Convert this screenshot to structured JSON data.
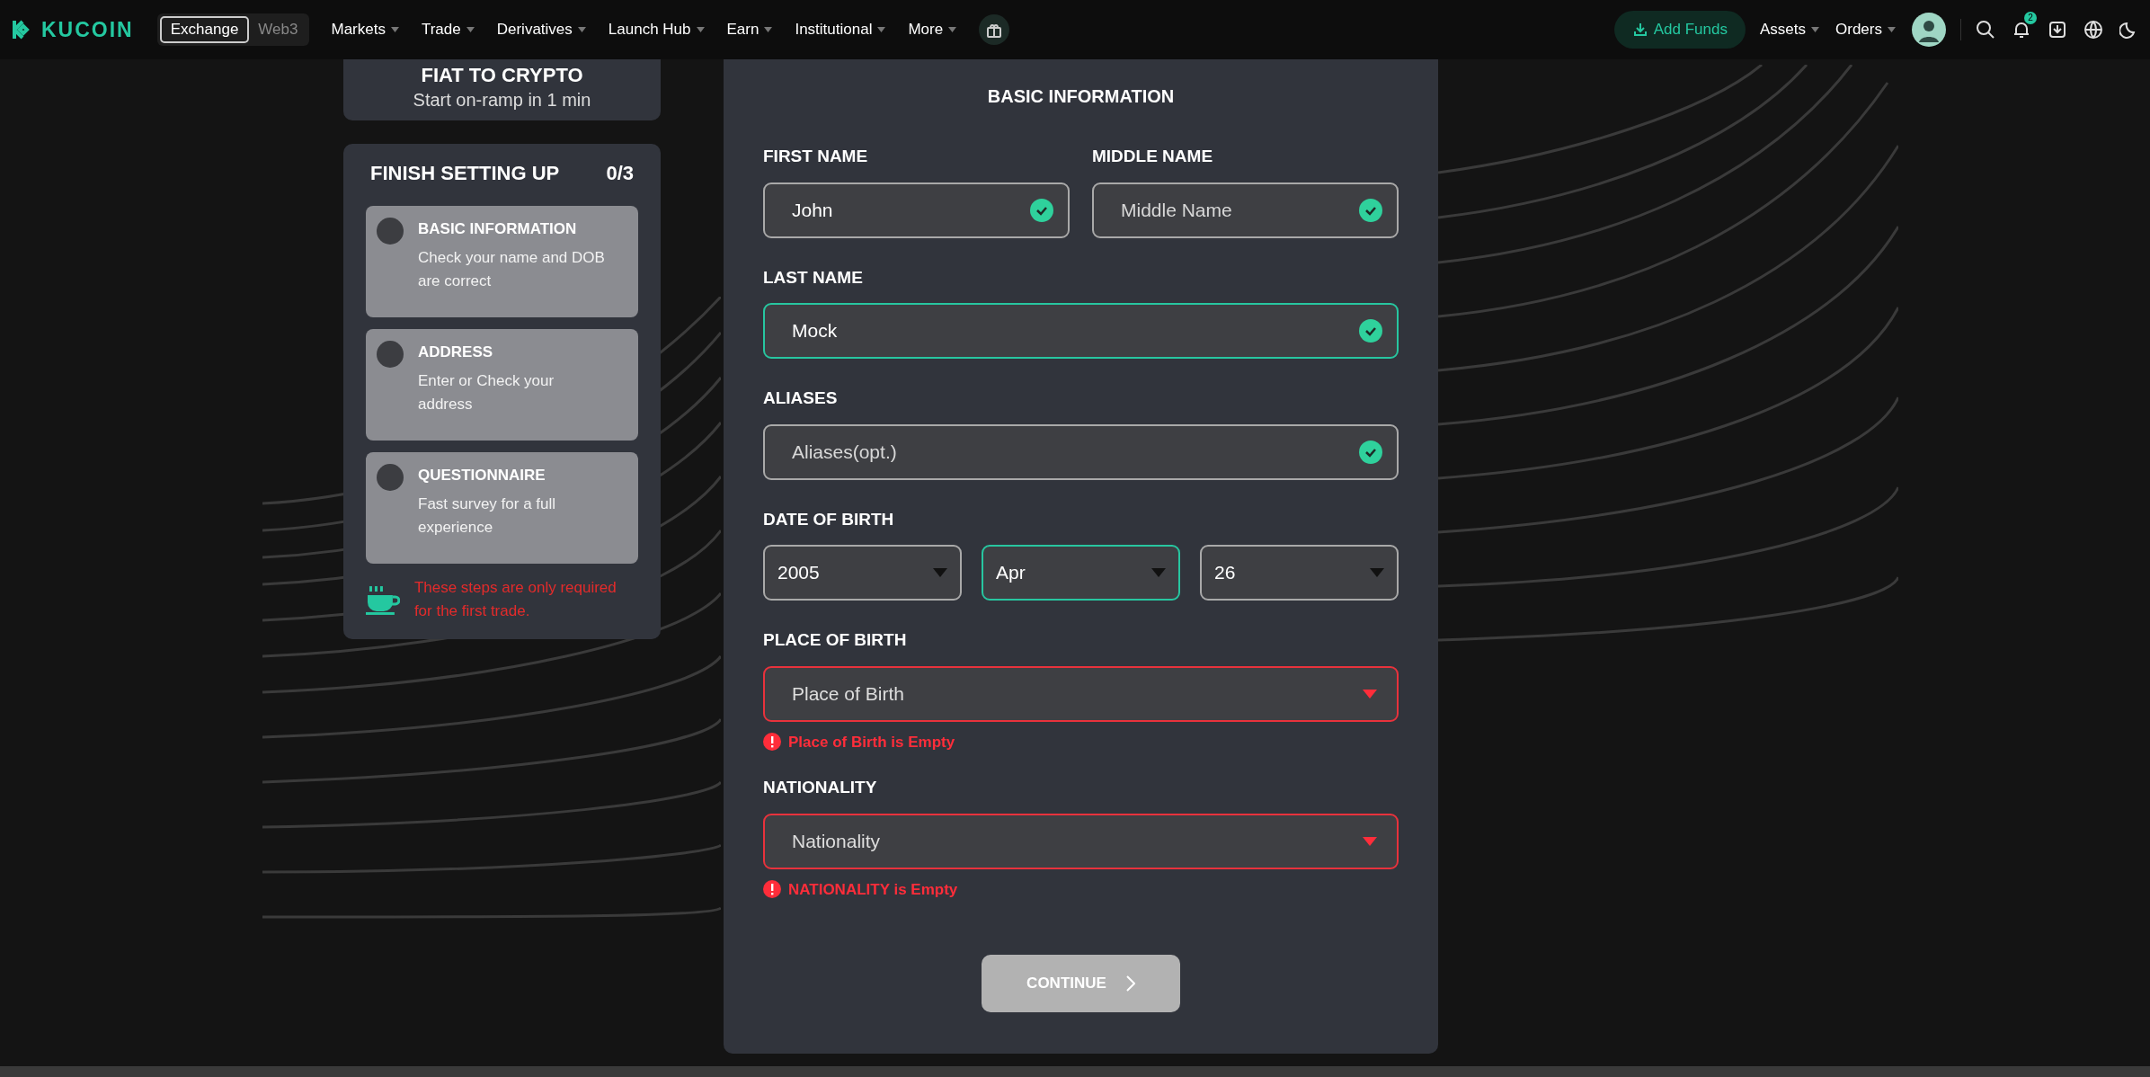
{
  "nav": {
    "logo": "KUCOIN",
    "mode_tabs": [
      {
        "label": "Exchange",
        "selected": true
      },
      {
        "label": "Web3",
        "selected": false
      }
    ],
    "menu": [
      "Markets",
      "Trade",
      "Derivatives",
      "Launch Hub",
      "Earn",
      "Institutional",
      "More"
    ],
    "add_funds": "Add Funds",
    "account_menu": [
      "Assets",
      "Orders"
    ],
    "notification_count": "2"
  },
  "promo": {
    "title": "FIAT TO CRYPTO",
    "subtitle": "Start on-ramp in 1 min"
  },
  "setup": {
    "title": "FINISH SETTING UP",
    "progress": "0/3",
    "steps": [
      {
        "title": "BASIC INFORMATION",
        "description": "Check your name and DOB are correct",
        "done": false
      },
      {
        "title": "ADDRESS",
        "description": "Enter or Check your address",
        "done": false
      },
      {
        "title": "QUESTIONNAIRE",
        "description": "Fast survey for a full experience",
        "done": false
      }
    ],
    "note": "These steps are only required for the first trade."
  },
  "form": {
    "title": "BASIC INFORMATION",
    "rows": [
      [
        {
          "label": "FIRST NAME",
          "controls": [
            {
              "kind": "text",
              "value": "John",
              "valid": true,
              "focused": false
            }
          ]
        },
        {
          "label": "MIDDLE NAME",
          "controls": [
            {
              "kind": "text",
              "placeholder": "Middle Name",
              "valid": true,
              "focused": false
            }
          ]
        }
      ],
      [
        {
          "label": "LAST NAME",
          "controls": [
            {
              "kind": "text",
              "value": "Mock",
              "valid": true,
              "focused": true
            }
          ]
        }
      ],
      [
        {
          "label": "ALIASES",
          "controls": [
            {
              "kind": "text",
              "placeholder": "Aliases(opt.)",
              "valid": true,
              "focused": false
            }
          ]
        }
      ],
      [
        {
          "label": "DATE OF BIRTH",
          "controls": [
            {
              "kind": "select",
              "value": "2005",
              "focused": false
            },
            {
              "kind": "select",
              "value": "Apr",
              "focused": true
            },
            {
              "kind": "select",
              "value": "26",
              "focused": false
            }
          ]
        }
      ],
      [
        {
          "label": "PLACE OF BIRTH",
          "controls": [
            {
              "kind": "select",
              "placeholder": "Place of Birth"
            }
          ],
          "error": "Place of Birth is Empty"
        }
      ],
      [
        {
          "label": "NATIONALITY",
          "controls": [
            {
              "kind": "select",
              "placeholder": "Nationality"
            }
          ],
          "error": "NATIONALITY is Empty"
        }
      ]
    ],
    "continue_button": {
      "label": "CONTINUE",
      "disabled": true
    }
  }
}
